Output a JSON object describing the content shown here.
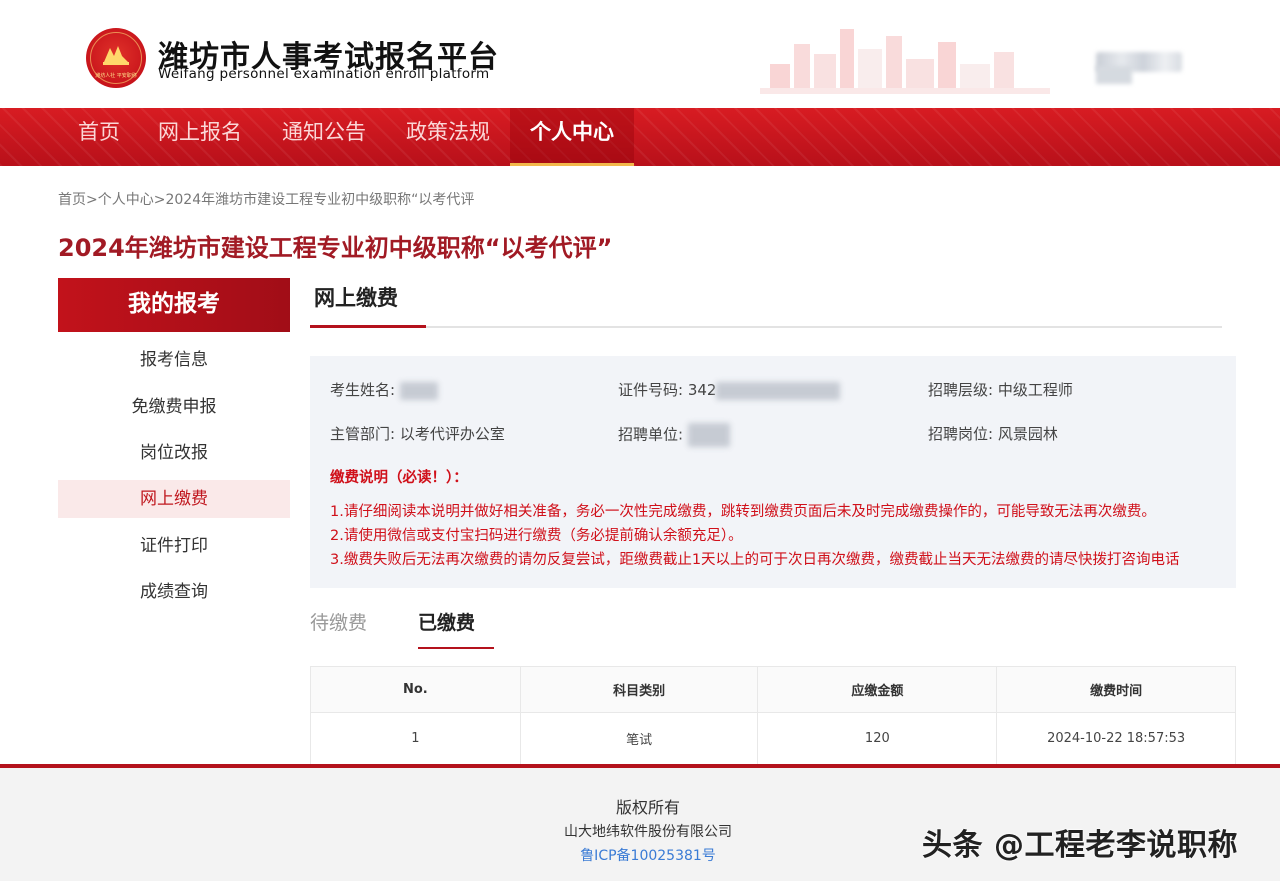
{
  "header": {
    "title": "潍坊市人事考试报名平台",
    "subtitle": "Weifang personnel examination enroll platform",
    "logo_text": "潍坊人社 平安职称"
  },
  "nav": {
    "items": [
      "首页",
      "网上报名",
      "通知公告",
      "政策法规",
      "个人中心"
    ],
    "active": "个人中心"
  },
  "breadcrumb": {
    "home": "首页",
    "sep": ">",
    "personal": "个人中心",
    "current": "2024年潍坊市建设工程专业初中级职称“以考代评"
  },
  "page_title": "2024年潍坊市建设工程专业初中级职称“以考代评”",
  "sidebar": {
    "heading": "我的报考",
    "items": [
      "报考信息",
      "免缴费申报",
      "岗位改报",
      "网上缴费",
      "证件打印",
      "成绩查询"
    ],
    "active": "网上缴费"
  },
  "section": {
    "title": "网上缴费"
  },
  "info": {
    "name_label": "考生姓名:",
    "id_label": "证件号码:",
    "id_value_prefix": "342",
    "level_label": "招聘层级:",
    "level_value": "中级工程师",
    "dept_label": "主管部门:",
    "dept_value": "以考代评办公室",
    "unit_label": "招聘单位:",
    "post_label": "招聘岗位:",
    "post_value": "风景园林"
  },
  "notice": {
    "title": "缴费说明（必读！）：",
    "lines": [
      "1.请仔细阅读本说明并做好相关准备，务必一次性完成缴费，跳转到缴费页面后未及时完成缴费操作的，可能导致无法再次缴费。",
      "2.请使用微信或支付宝扫码进行缴费（务必提前确认余额充足）。",
      "3.缴费失败后无法再次缴费的请勿反复尝试，距缴费截止1天以上的可于次日再次缴费，缴费截止当天无法缴费的请尽快拨打咨询电话"
    ]
  },
  "tabs": {
    "pending": "待缴费",
    "paid": "已缴费",
    "active": "已缴费"
  },
  "table": {
    "headers": [
      "No.",
      "科目类别",
      "应缴金额",
      "缴费时间"
    ],
    "rows": [
      [
        "1",
        "笔试",
        "120",
        "2024-10-22 18:57:53"
      ]
    ]
  },
  "footer": {
    "copyright": "版权所有",
    "company": "山大地纬软件股份有限公司",
    "icp": "鲁ICP备10025381号"
  },
  "watermark": "头条 @工程老李说职称",
  "colors": {
    "brand_red": "#b4121c",
    "nav_red": "#d81c22",
    "notice_red": "#d0101a",
    "link_blue": "#3a7bd5"
  }
}
